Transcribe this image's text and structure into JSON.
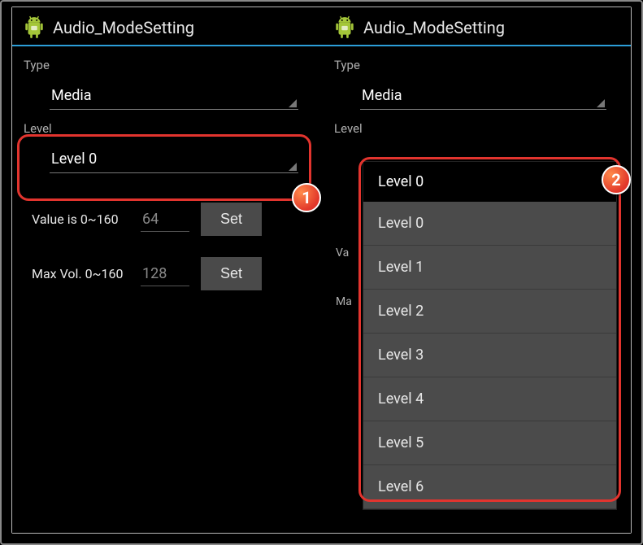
{
  "left": {
    "title": "Audio_ModeSetting",
    "type_label": "Type",
    "type_value": "Media",
    "level_label": "Level",
    "level_value": "Level 0",
    "value_label": "Value is 0~160",
    "value_input": "64",
    "max_label": "Max Vol. 0~160",
    "max_input": "128",
    "set_btn": "Set",
    "badge": "1"
  },
  "right": {
    "title": "Audio_ModeSetting",
    "type_label": "Type",
    "type_value": "Media",
    "level_label": "Level",
    "value_peek": "Va",
    "max_peek": "Ma",
    "dropdown_selected": "Level 0",
    "dropdown_items": {
      "0": "Level 0",
      "1": "Level 1",
      "2": "Level 2",
      "3": "Level 3",
      "4": "Level 4",
      "5": "Level 5",
      "6": "Level 6"
    },
    "badge": "2"
  }
}
